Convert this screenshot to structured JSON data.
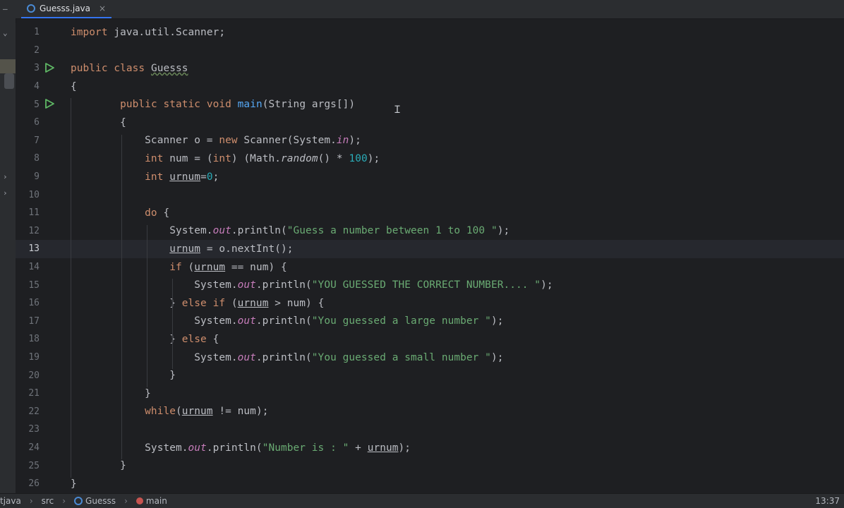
{
  "tab": {
    "title": "Guesss.java",
    "icon": "java-class-icon",
    "close": "×"
  },
  "code_lines": [
    "import java.util.Scanner;",
    "",
    "public class Guesss",
    "{",
    "        public static void main(String args[])",
    "        {",
    "            Scanner o = new Scanner(System.in);",
    "            int num = (int) (Math.random() * 100);",
    "            int urnum=0;",
    "",
    "            do {",
    "                System.out.println(\"Guess a number between 1 to 100 \");",
    "                urnum = o.nextInt();",
    "                if (urnum == num) {",
    "                    System.out.println(\"YOU GUESSED THE CORRECT NUMBER.... \");",
    "                } else if (urnum > num) {",
    "                    System.out.println(\"You guessed a large number \");",
    "                } else {",
    "                    System.out.println(\"You guessed a small number \");",
    "                }",
    "            }",
    "            while(urnum != num);",
    "",
    "            System.out.println(\"Number is : \" + urnum);",
    "        }",
    "}"
  ],
  "line_numbers": [
    "1",
    "2",
    "3",
    "4",
    "5",
    "6",
    "7",
    "8",
    "9",
    "10",
    "11",
    "12",
    "13",
    "14",
    "15",
    "16",
    "17",
    "18",
    "19",
    "20",
    "21",
    "22",
    "23",
    "24",
    "25",
    "26"
  ],
  "current_line": 13,
  "run_gutter_lines": [
    3,
    5
  ],
  "statusbar": {
    "crumbs": [
      "tjava",
      "src",
      "Guesss",
      "main"
    ],
    "time": "13:37"
  },
  "colors": {
    "keyword": "#cf8e6d",
    "method": "#56a8f5",
    "string": "#6aab73",
    "number": "#2aacb8",
    "static_field": "#c77dbb",
    "text": "#bcbec4",
    "run": "#5fb865"
  }
}
